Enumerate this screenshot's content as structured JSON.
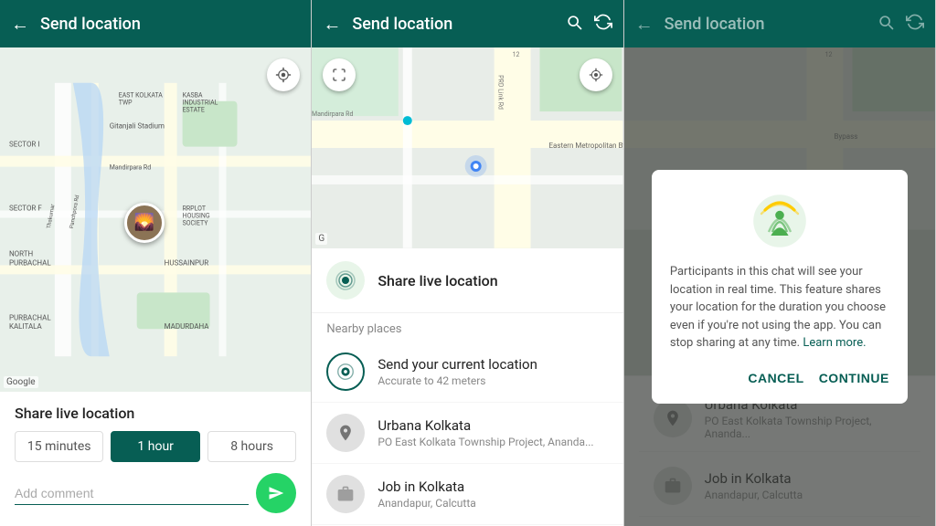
{
  "panels": {
    "panel1": {
      "header": {
        "title": "Send location",
        "back_icon": "←",
        "icons": []
      },
      "share_live_title": "Share live location",
      "time_options": [
        {
          "label": "15 minutes",
          "active": false
        },
        {
          "label": "1 hour",
          "active": true
        },
        {
          "label": "8 hours",
          "active": false
        }
      ],
      "comment_placeholder": "Add comment",
      "send_icon": "➤",
      "google_text": "Google"
    },
    "panel2": {
      "header": {
        "title": "Send location",
        "back_icon": "←",
        "search_icon": "🔍",
        "refresh_icon": "↻"
      },
      "share_live_label": "Share live location",
      "nearby_label": "Nearby places",
      "locations": [
        {
          "title": "Send your current location",
          "subtitle": "Accurate to 42 meters",
          "type": "current"
        },
        {
          "title": "Urbana Kolkata",
          "subtitle": "PO East Kolkata Township Project, Ananda...",
          "type": "place"
        },
        {
          "title": "Job in Kolkata",
          "subtitle": "Anandapur, Calcutta",
          "type": "job"
        }
      ],
      "google_text": "G"
    },
    "panel3": {
      "header": {
        "title": "Send location",
        "back_icon": "←",
        "search_icon": "🔍",
        "refresh_icon": "↻"
      },
      "dialog": {
        "body_text": "Participants in this chat will see your location in real time. This feature shares your location for the duration you choose even if you're not using the app. You can stop sharing at any time.",
        "learn_more": "Learn more.",
        "cancel_label": "CANCEL",
        "continue_label": "CONTINUE"
      },
      "locations": [
        {
          "title": "Urbana Kolkata",
          "subtitle": "PO East Kolkata Township Project, Ananda...",
          "type": "place"
        },
        {
          "title": "Job in Kolkata",
          "subtitle": "Anandapur, Calcutta",
          "type": "job"
        }
      ]
    }
  }
}
